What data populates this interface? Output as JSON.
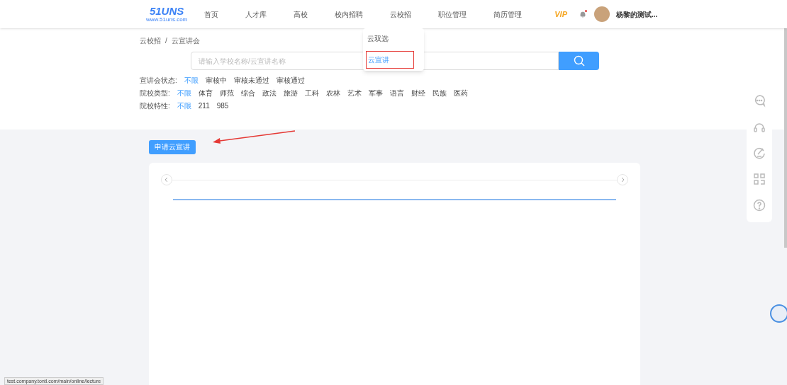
{
  "header": {
    "logo": {
      "text": "51UNS",
      "subtitle": "www.51uns.com"
    },
    "nav": [
      {
        "label": "首页",
        "selected": false
      },
      {
        "label": "人才库",
        "selected": false
      },
      {
        "label": "高校",
        "selected": false
      },
      {
        "label": "校内招聘",
        "selected": false
      },
      {
        "label": "云校招",
        "selected": false
      },
      {
        "label": "职位管理",
        "selected": false
      },
      {
        "label": "简历管理",
        "selected": false
      }
    ],
    "vip": "VIP",
    "has_notification": true,
    "user_name": "杨黎的测试..."
  },
  "dropdown": {
    "items": [
      {
        "label": "云双选",
        "selected": false
      },
      {
        "label": "云宣讲",
        "selected": true
      }
    ]
  },
  "breadcrumb": [
    "云校招",
    "/",
    "云宣讲会"
  ],
  "search": {
    "placeholder": "请输入学校名称/云宣讲名称"
  },
  "filters": [
    {
      "label": "宣讲会状态:",
      "options": [
        {
          "label": "不限",
          "selected": true
        },
        {
          "label": "审核中",
          "selected": false
        },
        {
          "label": "审核未通过",
          "selected": false
        },
        {
          "label": "审核通过",
          "selected": false
        }
      ]
    },
    {
      "label": "院校类型:",
      "options": [
        {
          "label": "不限",
          "selected": true
        },
        {
          "label": "体育",
          "selected": false
        },
        {
          "label": "师范",
          "selected": false
        },
        {
          "label": "综合",
          "selected": false
        },
        {
          "label": "政法",
          "selected": false
        },
        {
          "label": "旅游",
          "selected": false
        },
        {
          "label": "工科",
          "selected": false
        },
        {
          "label": "农林",
          "selected": false
        },
        {
          "label": "艺术",
          "selected": false
        },
        {
          "label": "军事",
          "selected": false
        },
        {
          "label": "语言",
          "selected": false
        },
        {
          "label": "财经",
          "selected": false
        },
        {
          "label": "民族",
          "selected": false
        },
        {
          "label": "医药",
          "selected": false
        }
      ]
    },
    {
      "label": "院校特性:",
      "options": [
        {
          "label": "不限",
          "selected": true
        },
        {
          "label": "211",
          "selected": false
        },
        {
          "label": "985",
          "selected": false
        }
      ]
    }
  ],
  "apply_button": "申请云宣讲",
  "status_url": "test.company.tontl.com/main/online/lecture"
}
